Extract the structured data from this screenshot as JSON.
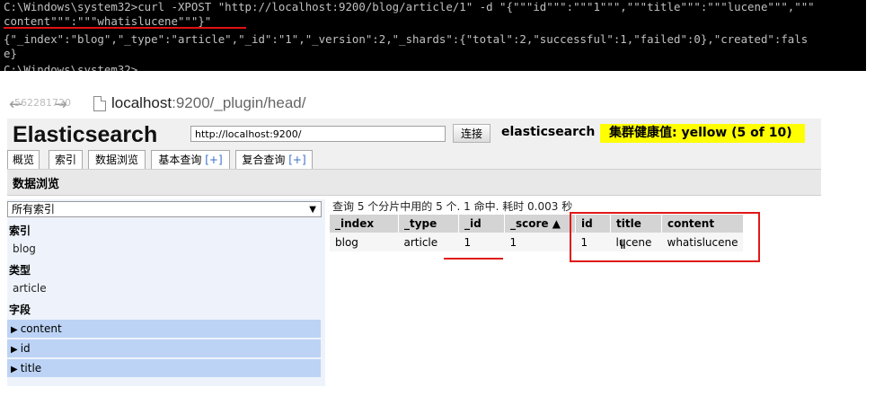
{
  "console": {
    "line1": "C:\\Windows\\system32>curl -XPOST \"http://localhost:9200/blog/article/1\" -d \"{\"\"\"id\"\"\":\"\"\"1\"\"\",\"\"\"title\"\"\":\"\"\"lucene\"\"\",\"\"\"",
    "line2": "content\"\"\":\"\"\"whatislucene\"\"\"}\"",
    "line3": "{\"_index\":\"blog\",\"_type\":\"article\",\"_id\":\"1\",\"_version\":2,\"_shards\":{\"total\":2,\"successful\":1,\"failed\":0},\"created\":fals",
    "line4": "e}",
    "line5": "C:\\Windows\\system32>"
  },
  "browser": {
    "ghost_text": "562281720",
    "url_host": "localhost",
    "url_rest": ":9200/_plugin/head/"
  },
  "header": {
    "title": "Elasticsearch",
    "connect_url": "http://localhost:9200/",
    "connect_label": "连接",
    "cluster_name": "elasticsearch",
    "health": "集群健康值: yellow (5 of 10)"
  },
  "tabs": [
    {
      "label": "概览",
      "plus": ""
    },
    {
      "label": "索引",
      "plus": ""
    },
    {
      "label": "数据浏览",
      "plus": ""
    },
    {
      "label": "基本查询 ",
      "plus": "[+]"
    },
    {
      "label": "复合查询 ",
      "plus": "[+]"
    }
  ],
  "section_title": "数据浏览",
  "sidebar": {
    "select_value": "所有索引",
    "index_heading": "索引",
    "index_item": "blog",
    "type_heading": "类型",
    "type_item": "article",
    "field_heading": "字段",
    "fields": [
      "content",
      "id",
      "title"
    ]
  },
  "results": {
    "query_info": "查询 5 个分片中用的 5 个. 1 命中. 耗时 0.003 秒",
    "columns": [
      "_index",
      "_type",
      "_id",
      "_score ▲",
      "id",
      "title",
      "content"
    ],
    "rows": [
      [
        "blog",
        "article",
        "1",
        "1",
        "1",
        "lucene",
        "whatislucene"
      ]
    ]
  },
  "colors": {
    "health_bg": "#ffff00",
    "highlight_red": "#e01818",
    "field_bg": "#bcd3f5"
  }
}
